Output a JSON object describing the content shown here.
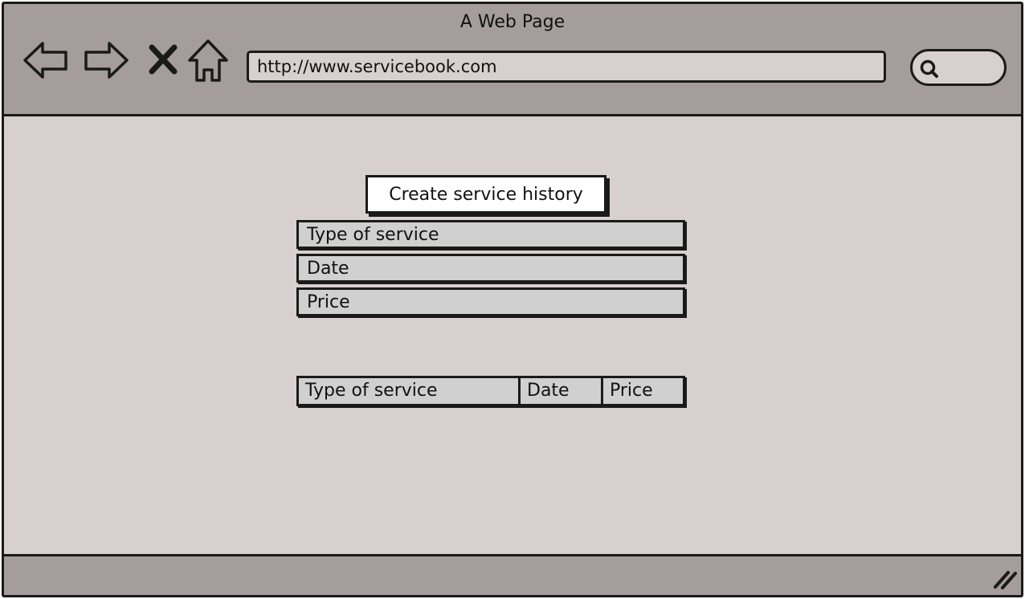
{
  "window": {
    "title": "A Web Page"
  },
  "toolbar": {
    "back_icon": "back-arrow-icon",
    "forward_icon": "forward-arrow-icon",
    "stop_icon": "close-icon",
    "home_icon": "home-icon",
    "url": "http://www.servicebook.com",
    "search_icon": "search-icon"
  },
  "form": {
    "create_button_label": "Create service history",
    "type_placeholder": "Type of service",
    "date_placeholder": "Date",
    "price_placeholder": "Price"
  },
  "table": {
    "columns": [
      "Type of service",
      "Date",
      "Price"
    ]
  },
  "colors": {
    "chrome": "#a59d9d",
    "page_background": "#d8d0d0",
    "field_background": "#d0d0d0",
    "outline": "#1a1a1a"
  }
}
